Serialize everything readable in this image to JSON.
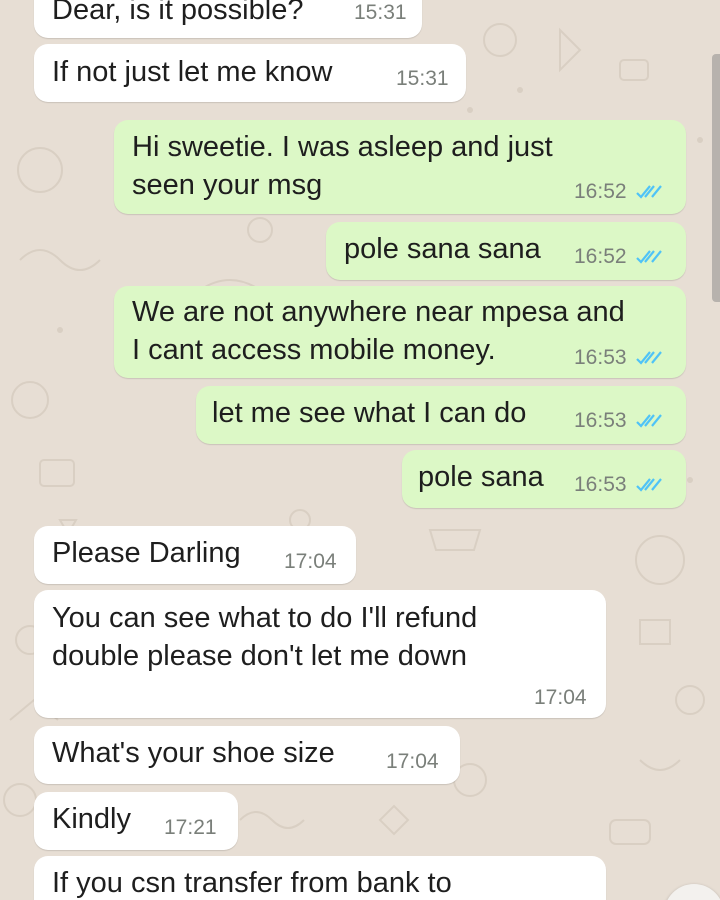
{
  "colors": {
    "wallpaper": "#e7ded4",
    "incoming_bubble": "#ffffff",
    "outgoing_bubble": "#dcf8c6",
    "read_ticks": "#4fc3f7",
    "timestamp": "#7a7f7a"
  },
  "icons": {
    "read_receipt": "double-check-icon"
  },
  "messages": [
    {
      "direction": "in",
      "lines": [
        "Dear, is it possible?"
      ],
      "time": "15:31"
    },
    {
      "direction": "in",
      "lines": [
        "If not just let me know"
      ],
      "time": "15:31"
    },
    {
      "direction": "out",
      "lines": [
        "Hi sweetie.  I was asleep and just",
        "seen your msg"
      ],
      "time": "16:52",
      "status": "read"
    },
    {
      "direction": "out",
      "lines": [
        "pole sana sana"
      ],
      "time": "16:52",
      "status": "read"
    },
    {
      "direction": "out",
      "lines": [
        "We are not anywhere near mpesa and",
        "I cant access mobile money."
      ],
      "time": "16:53",
      "status": "read"
    },
    {
      "direction": "out",
      "lines": [
        "let me see what I can do"
      ],
      "time": "16:53",
      "status": "read"
    },
    {
      "direction": "out",
      "lines": [
        "pole sana"
      ],
      "time": "16:53",
      "status": "read"
    },
    {
      "direction": "in",
      "lines": [
        "Please Darling"
      ],
      "time": "17:04"
    },
    {
      "direction": "in",
      "lines": [
        "You can see what to do I'll refund",
        "double please don't let me down"
      ],
      "time": "17:04"
    },
    {
      "direction": "in",
      "lines": [
        "What's your shoe size"
      ],
      "time": "17:04"
    },
    {
      "direction": "in",
      "lines": [
        "Kindly"
      ],
      "time": "17:21"
    },
    {
      "direction": "in",
      "lines": [
        "If you csn transfer from bank to"
      ],
      "time": ""
    }
  ]
}
